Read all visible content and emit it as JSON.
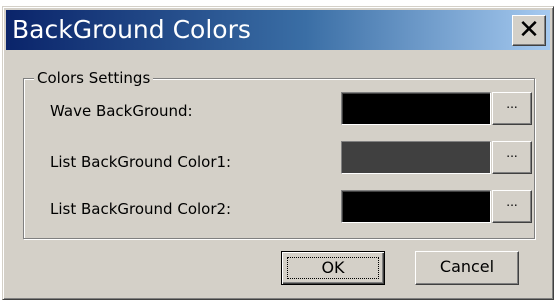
{
  "window": {
    "title": "BackGround Colors",
    "close_symbol": "✕",
    "close_icon": "close-icon"
  },
  "group": {
    "label": "Colors Settings"
  },
  "rows": [
    {
      "label": "Wave BackGround:",
      "color": "#000000",
      "button_label": "..."
    },
    {
      "label": "List BackGround Color1:",
      "color": "#404040",
      "button_label": "..."
    },
    {
      "label": "List BackGround Color2:",
      "color": "#000000",
      "button_label": "..."
    }
  ],
  "buttons": {
    "ok_label": "OK",
    "cancel_label": "Cancel"
  },
  "colors": {
    "title_gradient_start": "#0a246a",
    "title_gradient_end": "#a6caf0",
    "face": "#d4d0c8"
  }
}
